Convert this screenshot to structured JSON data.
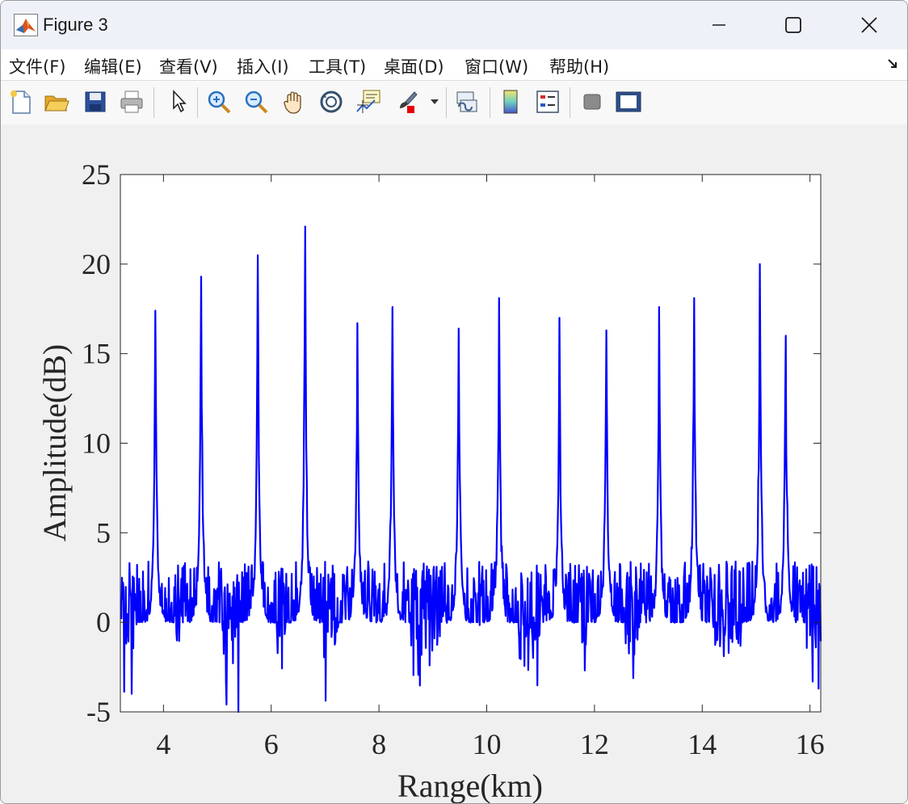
{
  "window": {
    "title": "Figure 3",
    "controls": [
      "minimize",
      "maximize",
      "close"
    ]
  },
  "menu": [
    {
      "label": "文件(F)"
    },
    {
      "label": "编辑(E)"
    },
    {
      "label": "查看(V)"
    },
    {
      "label": "插入(I)"
    },
    {
      "label": "工具(T)"
    },
    {
      "label": "桌面(D)"
    },
    {
      "label": "窗口(W)"
    },
    {
      "label": "帮助(H)"
    }
  ],
  "toolbar": {
    "buttons": [
      "new-figure-icon",
      "open-file-icon",
      "save-icon",
      "print-icon",
      "select-arrow-icon",
      "zoom-in-icon",
      "zoom-out-icon",
      "pan-hand-icon",
      "rotate-3d-icon",
      "data-cursor-icon",
      "brush-icon",
      "brush-dropdown-icon",
      "link-plot-icon",
      "colorbar-icon",
      "legend-icon",
      "hide-plot-tools-icon",
      "show-plot-tools-icon"
    ]
  },
  "colors": {
    "line": "#0000ff",
    "axes_background": "#ffffff",
    "figure_background": "#f0f0f0"
  },
  "chart_data": {
    "type": "line",
    "title": "",
    "xlabel": "Range(km)",
    "ylabel": "Amplitude(dB)",
    "xlim": [
      3.2,
      16.2
    ],
    "ylim": [
      -5,
      25
    ],
    "xticks": [
      4,
      6,
      8,
      10,
      12,
      14,
      16
    ],
    "yticks": [
      -5,
      0,
      5,
      10,
      15,
      20,
      25
    ],
    "grid": false,
    "legend": "none",
    "noise_floor_db": [
      -5,
      4
    ],
    "peaks": [
      {
        "x": 3.85,
        "y": 17.4
      },
      {
        "x": 4.7,
        "y": 19.3
      },
      {
        "x": 5.75,
        "y": 20.5
      },
      {
        "x": 6.63,
        "y": 22.1
      },
      {
        "x": 7.6,
        "y": 16.7
      },
      {
        "x": 8.25,
        "y": 17.6
      },
      {
        "x": 9.48,
        "y": 16.4
      },
      {
        "x": 10.23,
        "y": 18.1
      },
      {
        "x": 11.35,
        "y": 17.0
      },
      {
        "x": 12.22,
        "y": 16.3
      },
      {
        "x": 13.2,
        "y": 17.6
      },
      {
        "x": 13.85,
        "y": 18.1
      },
      {
        "x": 15.07,
        "y": 20.0
      },
      {
        "x": 15.55,
        "y": 16.0
      }
    ],
    "series": [
      {
        "color": "#0000ff"
      }
    ]
  }
}
